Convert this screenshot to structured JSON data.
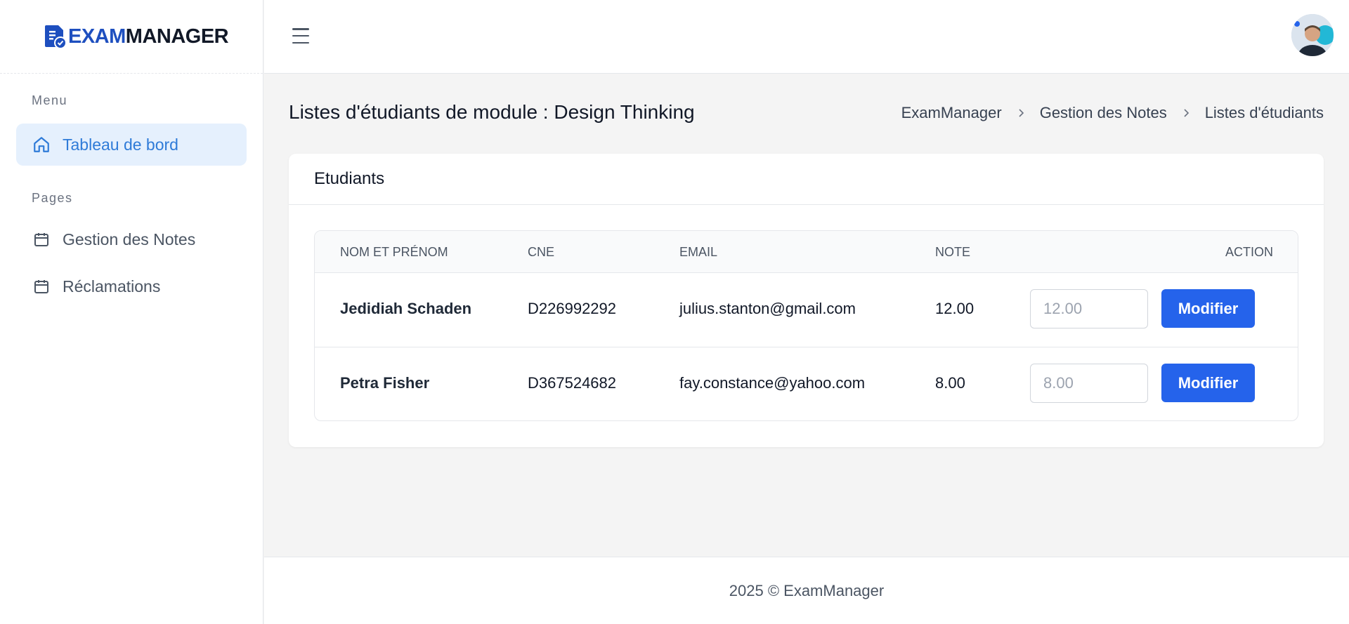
{
  "brand": {
    "part1": "EXAM",
    "part2": "MANAGER",
    "accent": "#1e4fbf"
  },
  "sidebar": {
    "menu_label": "Menu",
    "pages_label": "Pages",
    "items": [
      {
        "label": "Tableau de bord",
        "icon": "home-icon",
        "active": true
      },
      {
        "label": "Gestion des Notes",
        "icon": "calendar-icon"
      },
      {
        "label": "Réclamations",
        "icon": "calendar-icon"
      }
    ]
  },
  "header": {
    "menu_icon": "hamburger-icon",
    "avatar": "user-avatar"
  },
  "page": {
    "title": "Listes d'étudiants de module : Design Thinking",
    "breadcrumb": [
      "ExamManager",
      "Gestion des Notes",
      "Listes d'étudiants"
    ]
  },
  "card": {
    "title": "Etudiants",
    "columns": [
      "NOM ET PRÉNOM",
      "CNE",
      "EMAIL",
      "NOTE",
      "ACTION"
    ],
    "rows": [
      {
        "name": "Jedidiah Schaden",
        "cne": "D226992292",
        "email": "julius.stanton@gmail.com",
        "note": "12.00",
        "placeholder": "12.00",
        "button": "Modifier"
      },
      {
        "name": "Petra Fisher",
        "cne": "D367524682",
        "email": "fay.constance@yahoo.com",
        "note": "8.00",
        "placeholder": "8.00",
        "button": "Modifier"
      }
    ]
  },
  "footer": {
    "text": "2025 © ExamManager"
  },
  "colors": {
    "primary": "#2563eb",
    "active_bg": "#e5f0fd",
    "active_text": "#2f7bd8"
  }
}
